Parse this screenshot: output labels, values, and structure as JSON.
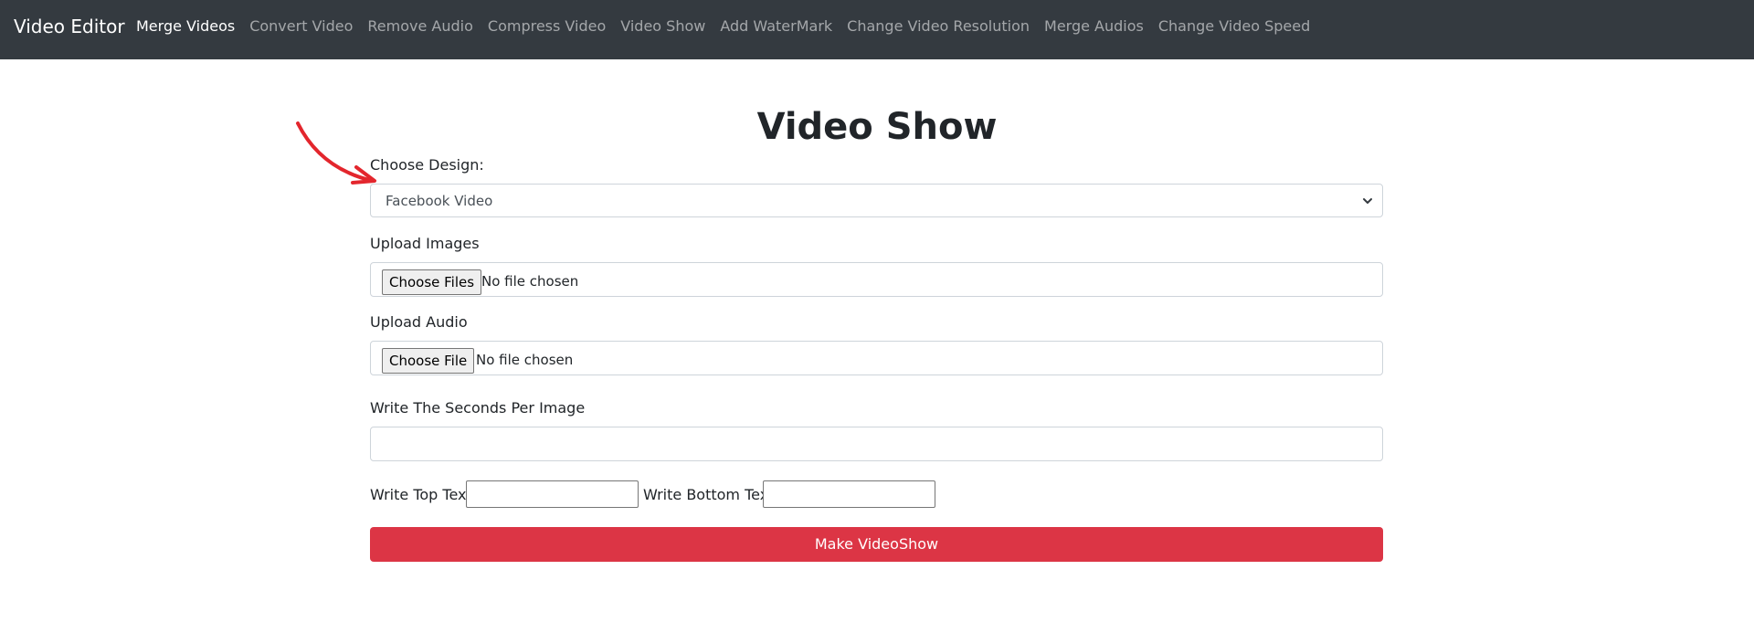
{
  "navbar": {
    "brand": "Video Editor",
    "links": [
      {
        "label": "Merge Videos",
        "active": true
      },
      {
        "label": "Convert Video",
        "active": false
      },
      {
        "label": "Remove Audio",
        "active": false
      },
      {
        "label": "Compress Video",
        "active": false
      },
      {
        "label": "Video Show",
        "active": false
      },
      {
        "label": "Add WaterMark",
        "active": false
      },
      {
        "label": "Change Video Resolution",
        "active": false
      },
      {
        "label": "Merge Audios",
        "active": false
      },
      {
        "label": "Change Video Speed",
        "active": false
      }
    ]
  },
  "page": {
    "title": "Video Show"
  },
  "form": {
    "design_label": "Choose Design:",
    "design_value": "Facebook Video",
    "images_label": "Upload Images",
    "images_button": "Choose Files",
    "images_status": "No file chosen",
    "audio_label": "Upload Audio",
    "audio_button": "Choose File",
    "audio_status": "No file chosen",
    "seconds_label": "Write The Seconds Per Image",
    "seconds_value": "",
    "top_text_label": "Write Top Text",
    "top_text_value": "",
    "bottom_text_label": "Write Bottom Text",
    "bottom_text_value": "",
    "submit_label": "Make VideoShow"
  },
  "colors": {
    "navbar_bg": "#343a40",
    "submit_bg": "#dc3545",
    "annotation_arrow": "#e3262d"
  },
  "icons": {
    "select_chevron": "chevron-down-icon",
    "annotation": "red-arrow-icon"
  }
}
